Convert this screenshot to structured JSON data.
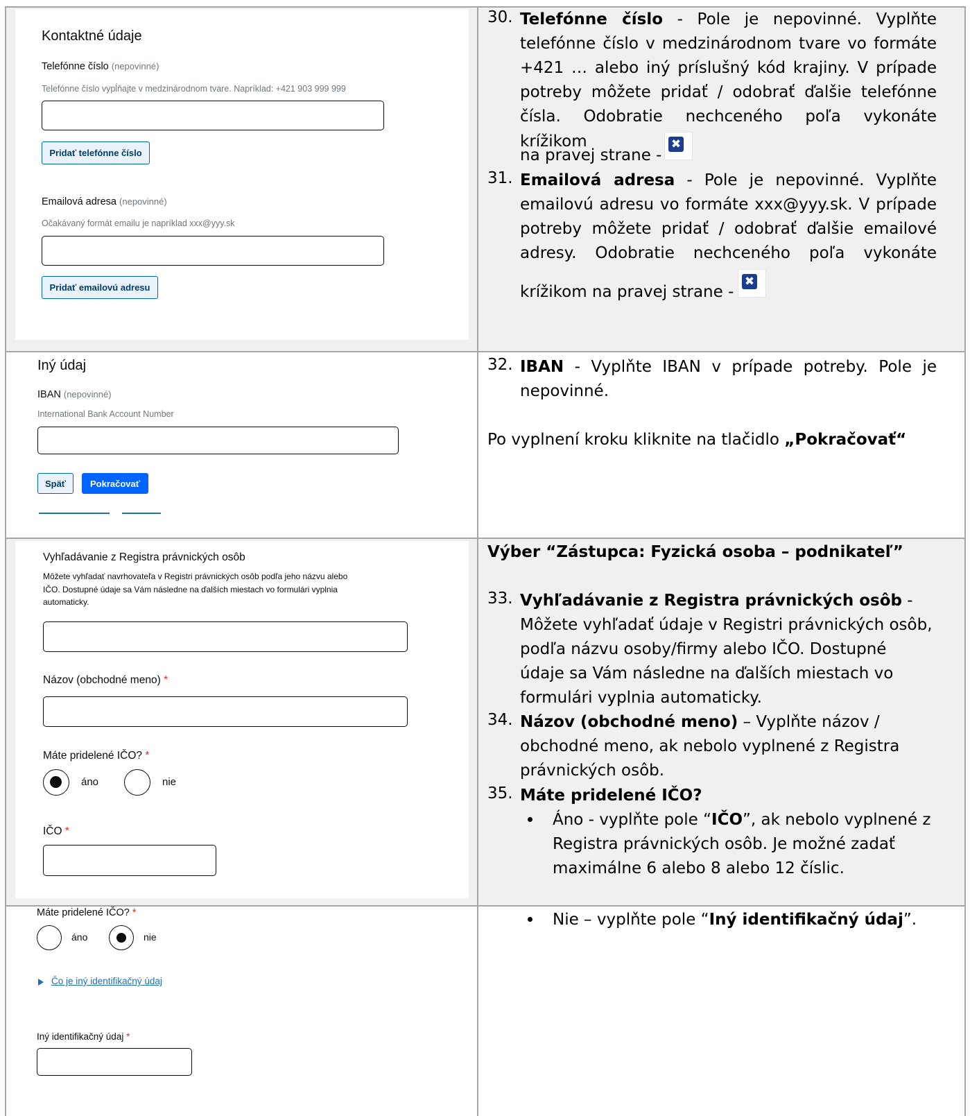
{
  "section1": {
    "form": {
      "title": "Kontaktné údaje",
      "phone_label": "Telefónne číslo",
      "phone_optional": "(nepovinné)",
      "phone_hint": "Telefónne číslo vypĺňajte v medzinárodnom tvare. Napríklad: +421 903 999 999",
      "phone_value": "",
      "add_phone_button": "Pridať telefónne číslo",
      "email_label": "Emailová adresa",
      "email_optional": "(nepovinné)",
      "email_hint": "Očakávaný formát emailu je napríklad xxx@yyy.sk",
      "email_value": "",
      "add_email_button": "Pridať emailovú adresu"
    },
    "instructions": {
      "item30": {
        "num": "30.",
        "title": "Telefónne číslo",
        "l1_rest": "- Pole je nepovinné. Vyplňte",
        "l2": "telefónne číslo v medzinárodnom tvare vo formáte",
        "l3": "+421 … alebo iný príslušný kód krajiny. V prípade",
        "l4": "potreby môžete pridať / odobrať ďalšie telefónne",
        "l5": "čísla. Odobratie nechceného poľa vykonáte krížikom",
        "l6": "na pravej strane -"
      },
      "item31": {
        "num": "31.",
        "title": "Emailová adresa",
        "l1_rest": "- Pole je nepovinné. Vyplňte",
        "l2": "emailovú adresu vo formáte xxx@yyy.sk. V prípade",
        "l3": "potreby môžete pridať / odobrať ďalšie emailové",
        "l4": "adresy. Odobratie nechceného poľa vykonáte",
        "l5": "krížikom na pravej strane -"
      },
      "remove_icon": "✖"
    }
  },
  "section2": {
    "form": {
      "title": "Iný údaj",
      "iban_label": "IBAN",
      "iban_optional": "(nepovinné)",
      "iban_hint": "International Bank Account Number",
      "iban_value": "",
      "back_button": "Späť",
      "continue_button": "Pokračovať"
    },
    "instructions": {
      "item32": {
        "num": "32.",
        "title": "IBAN",
        "l1_rest": "- Vyplňte IBAN v prípade potreby. Pole je",
        "l2": "nepovinné."
      },
      "after_prefix": "Po vyplnení kroku kliknite na tlačidlo ",
      "after_bold": "„Pokračovať“"
    }
  },
  "section3": {
    "form": {
      "search_title": "Vyhľadávanie z Registra právnických osôb",
      "search_desc_l1": "Môžete vyhľadať navrhovateľa v Registri právnických osôb podľa jeho názvu alebo",
      "search_desc_l2": "IČO. Dostupné údaje sa Vám následne na ďalších miestach vo formulári vyplnia",
      "search_desc_l3": "automaticky.",
      "search_value": "",
      "name_label": "Názov (obchodné meno)",
      "name_value": "",
      "ico_question": "Máte pridelené IČO?",
      "yes": "áno",
      "no": "nie",
      "ico_label": "IČO",
      "ico_value": "",
      "required_mark": "*"
    },
    "instructions": {
      "heading": "Výber “Zástupca: Fyzická osoba – podnikateľ”",
      "item33": {
        "num": "33.",
        "title": "Vyhľadávanie z Registra právnických osôb",
        "title_suffix": " -",
        "l2": "Môžete vyhľadať údaje v Registri právnických osôb,",
        "l3": "podľa názvu osoby/firmy alebo IČO. Dostupné",
        "l4": "údaje sa Vám následne na ďalších miestach vo",
        "l5": "formulári vyplnia automaticky."
      },
      "item34": {
        "num": "34.",
        "title": "Názov (obchodné meno)",
        "l1_rest": " – Vyplňte názov /",
        "l2": "obchodné meno, ak nebolo vyplnené z Registra",
        "l3": "právnických osôb."
      },
      "item35": {
        "num": "35.",
        "title": "Máte pridelené IČO?",
        "b1_pre": "Áno - vyplňte pole “",
        "b1_bold": "IČO",
        "b1_post": "”, ak nebolo vyplnené z",
        "b1_l2": "Registra právnických osôb. Je možné zadať",
        "b1_l3": "maximálne 6 alebo 8 alebo 12 číslic."
      }
    }
  },
  "section4": {
    "form": {
      "ico_question": "Máte pridelené IČO?",
      "yes": "áno",
      "no": "nie",
      "link": "Čo je iný identifikačný údaj",
      "other_label": "Iný identifikačný údaj",
      "other_value": "",
      "required_mark": "*"
    },
    "instructions": {
      "b2_pre": "Nie – vyplňte pole “",
      "b2_bold": "Iný identifikačný údaj",
      "b2_post": "”."
    }
  }
}
